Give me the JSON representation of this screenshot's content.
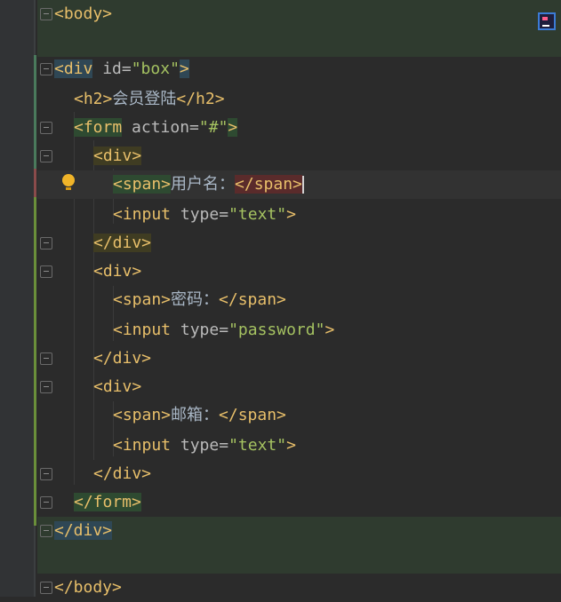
{
  "editor": {
    "lines": [
      {
        "tokens": [
          {
            "t": "<body>",
            "c": "tag"
          }
        ]
      },
      {
        "tokens": []
      },
      {
        "tokens": [
          {
            "t": "<div",
            "c": "tag"
          },
          {
            "t": " id",
            "c": "attr"
          },
          {
            "t": "=",
            "c": "eq"
          },
          {
            "t": "\"box\"",
            "c": "str"
          },
          {
            "t": ">",
            "c": "tag"
          }
        ]
      },
      {
        "tokens": [
          {
            "t": "<h2>",
            "c": "tag"
          },
          {
            "t": "会员登陆",
            "c": "txt"
          },
          {
            "t": "</h2>",
            "c": "tag"
          }
        ]
      },
      {
        "tokens": [
          {
            "t": "<form",
            "c": "tag"
          },
          {
            "t": " action",
            "c": "attr"
          },
          {
            "t": "=",
            "c": "eq"
          },
          {
            "t": "\"#\"",
            "c": "str"
          },
          {
            "t": ">",
            "c": "tag"
          }
        ]
      },
      {
        "tokens": [
          {
            "t": "<div>",
            "c": "tag"
          }
        ]
      },
      {
        "tokens": [
          {
            "t": "<span>",
            "c": "tag"
          },
          {
            "t": "用户名：",
            "c": "txt"
          },
          {
            "t": "</span>",
            "c": "tag"
          }
        ]
      },
      {
        "tokens": [
          {
            "t": "<input",
            "c": "tag"
          },
          {
            "t": " type",
            "c": "attr"
          },
          {
            "t": "=",
            "c": "eq"
          },
          {
            "t": "\"text\"",
            "c": "str"
          },
          {
            "t": ">",
            "c": "tag"
          }
        ]
      },
      {
        "tokens": [
          {
            "t": "</div>",
            "c": "tag"
          }
        ]
      },
      {
        "tokens": [
          {
            "t": "<div>",
            "c": "tag"
          }
        ]
      },
      {
        "tokens": [
          {
            "t": "<span>",
            "c": "tag"
          },
          {
            "t": "密码：",
            "c": "txt"
          },
          {
            "t": "</span>",
            "c": "tag"
          }
        ]
      },
      {
        "tokens": [
          {
            "t": "<input",
            "c": "tag"
          },
          {
            "t": " type",
            "c": "attr"
          },
          {
            "t": "=",
            "c": "eq"
          },
          {
            "t": "\"password\"",
            "c": "str"
          },
          {
            "t": ">",
            "c": "tag"
          }
        ]
      },
      {
        "tokens": [
          {
            "t": "</div>",
            "c": "tag"
          }
        ]
      },
      {
        "tokens": [
          {
            "t": "<div>",
            "c": "tag"
          }
        ]
      },
      {
        "tokens": [
          {
            "t": "<span>",
            "c": "tag"
          },
          {
            "t": "邮箱：",
            "c": "txt"
          },
          {
            "t": "</span>",
            "c": "tag"
          }
        ]
      },
      {
        "tokens": [
          {
            "t": "<input",
            "c": "tag"
          },
          {
            "t": " type",
            "c": "attr"
          },
          {
            "t": "=",
            "c": "eq"
          },
          {
            "t": "\"text\"",
            "c": "str"
          },
          {
            "t": ">",
            "c": "tag"
          }
        ]
      },
      {
        "tokens": [
          {
            "t": "</div>",
            "c": "tag"
          }
        ]
      },
      {
        "tokens": [
          {
            "t": "</form>",
            "c": "tag"
          }
        ]
      },
      {
        "tokens": [
          {
            "t": "</div>",
            "c": "tag"
          }
        ]
      },
      {
        "tokens": []
      },
      {
        "tokens": [
          {
            "t": "</body>",
            "c": "tag"
          }
        ]
      }
    ]
  },
  "icons": {
    "hint": "lightbulb-icon",
    "ide": "intellij-icon"
  }
}
